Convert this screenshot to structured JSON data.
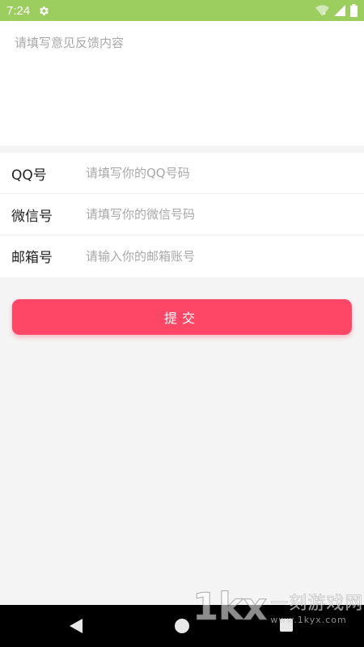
{
  "status_bar": {
    "time": "7:24",
    "background": "#9ccd5f",
    "icons": [
      "gear-icon",
      "wifi-icon",
      "signal-icon",
      "battery-icon"
    ]
  },
  "feedback": {
    "placeholder": "请填写意见反馈内容",
    "value": ""
  },
  "form": {
    "rows": [
      {
        "label": "QQ号",
        "placeholder": "请填写你的QQ号码",
        "value": ""
      },
      {
        "label": "微信号",
        "placeholder": "请填写你的微信号码",
        "value": ""
      },
      {
        "label": "邮箱号",
        "placeholder": "请输入你的邮箱账号",
        "value": ""
      }
    ]
  },
  "submit": {
    "label": "提交",
    "color": "#fe4766"
  },
  "nav_bar": {
    "icons": [
      "back-icon",
      "home-icon",
      "recent-apps-icon"
    ]
  },
  "watermark": {
    "logo": "1kx",
    "name": "一刻游戏网",
    "url": "www.1kyx.com"
  }
}
